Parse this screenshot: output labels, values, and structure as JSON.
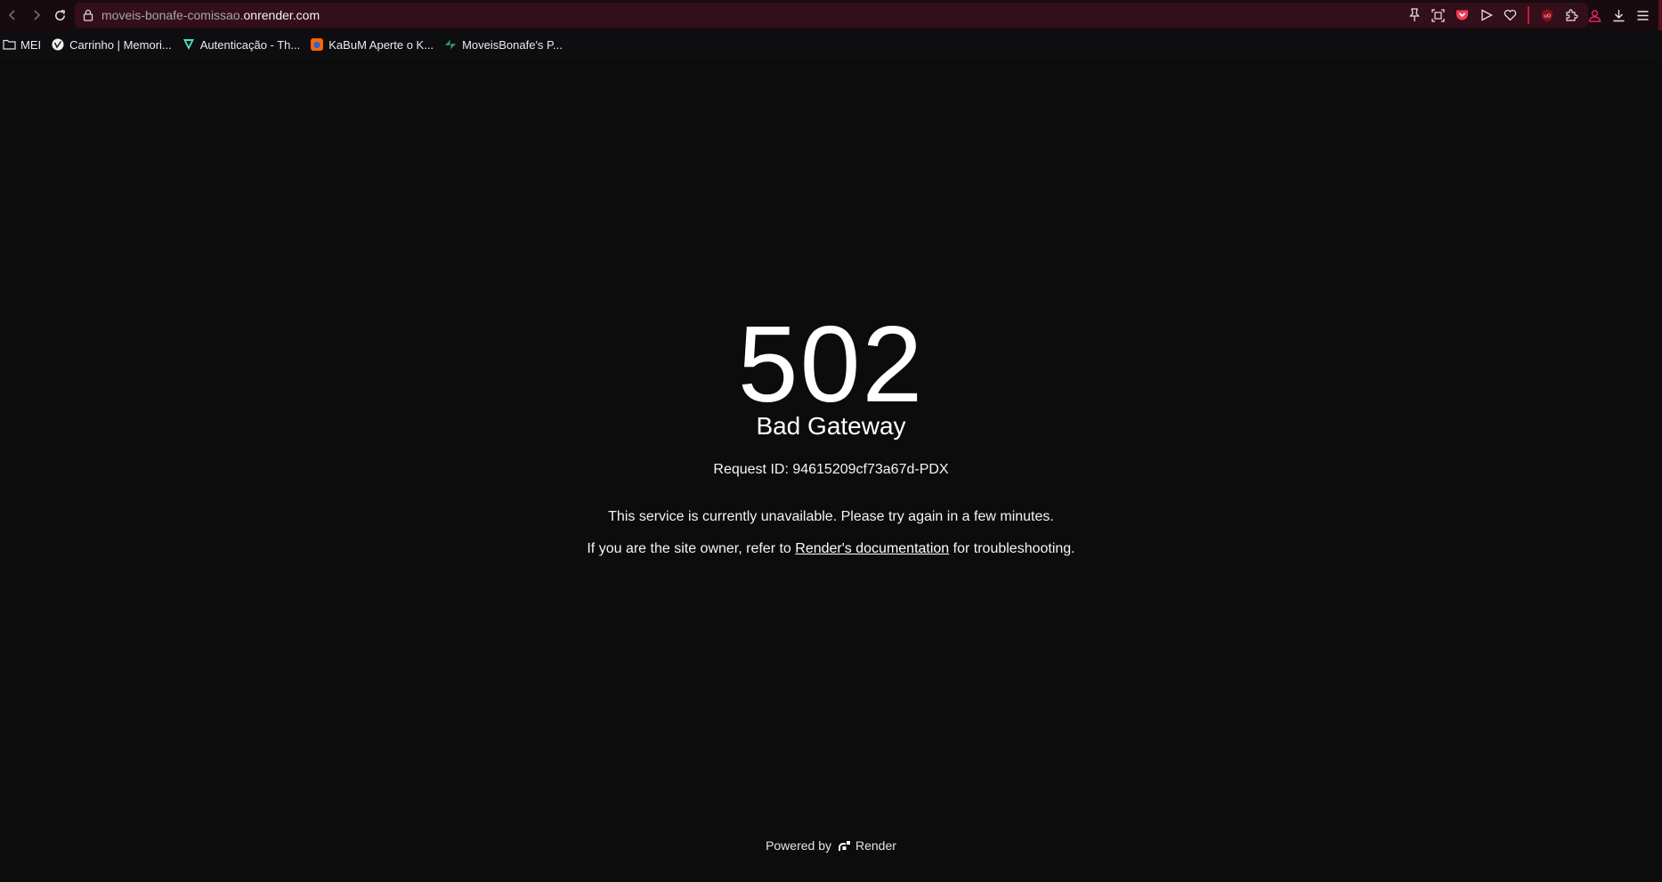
{
  "browser": {
    "url_path_part": "moveis-bonafe-comissao.",
    "url_domain_part": "onrender.com",
    "toolbar_icons": [
      "pin-icon",
      "screenshot-icon",
      "pocket-icon",
      "send-icon",
      "heart-icon",
      "ublock-icon",
      "extensions-icon",
      "profile-icon",
      "download-icon",
      "menu-icon"
    ]
  },
  "bookmarks": [
    {
      "label": "MEI",
      "icon": "folder-icon"
    },
    {
      "label": "Carrinho | Memori...",
      "icon": "site-icon"
    },
    {
      "label": "Autenticação - Th...",
      "icon": "site-icon"
    },
    {
      "label": "KaBuM Aperte o K...",
      "icon": "site-icon"
    },
    {
      "label": "MoveisBonafe's P...",
      "icon": "site-icon"
    }
  ],
  "error": {
    "code": "502",
    "title": "Bad Gateway",
    "request_id": "Request ID: 94615209cf73a67d-PDX",
    "message": "This service is currently unavailable. Please try again in a few minutes.",
    "owner_prefix": "If you are the site owner, refer to ",
    "owner_link": "Render's documentation",
    "owner_suffix": " for troubleshooting."
  },
  "footer": {
    "powered_by": "Powered by",
    "brand": "Render"
  }
}
